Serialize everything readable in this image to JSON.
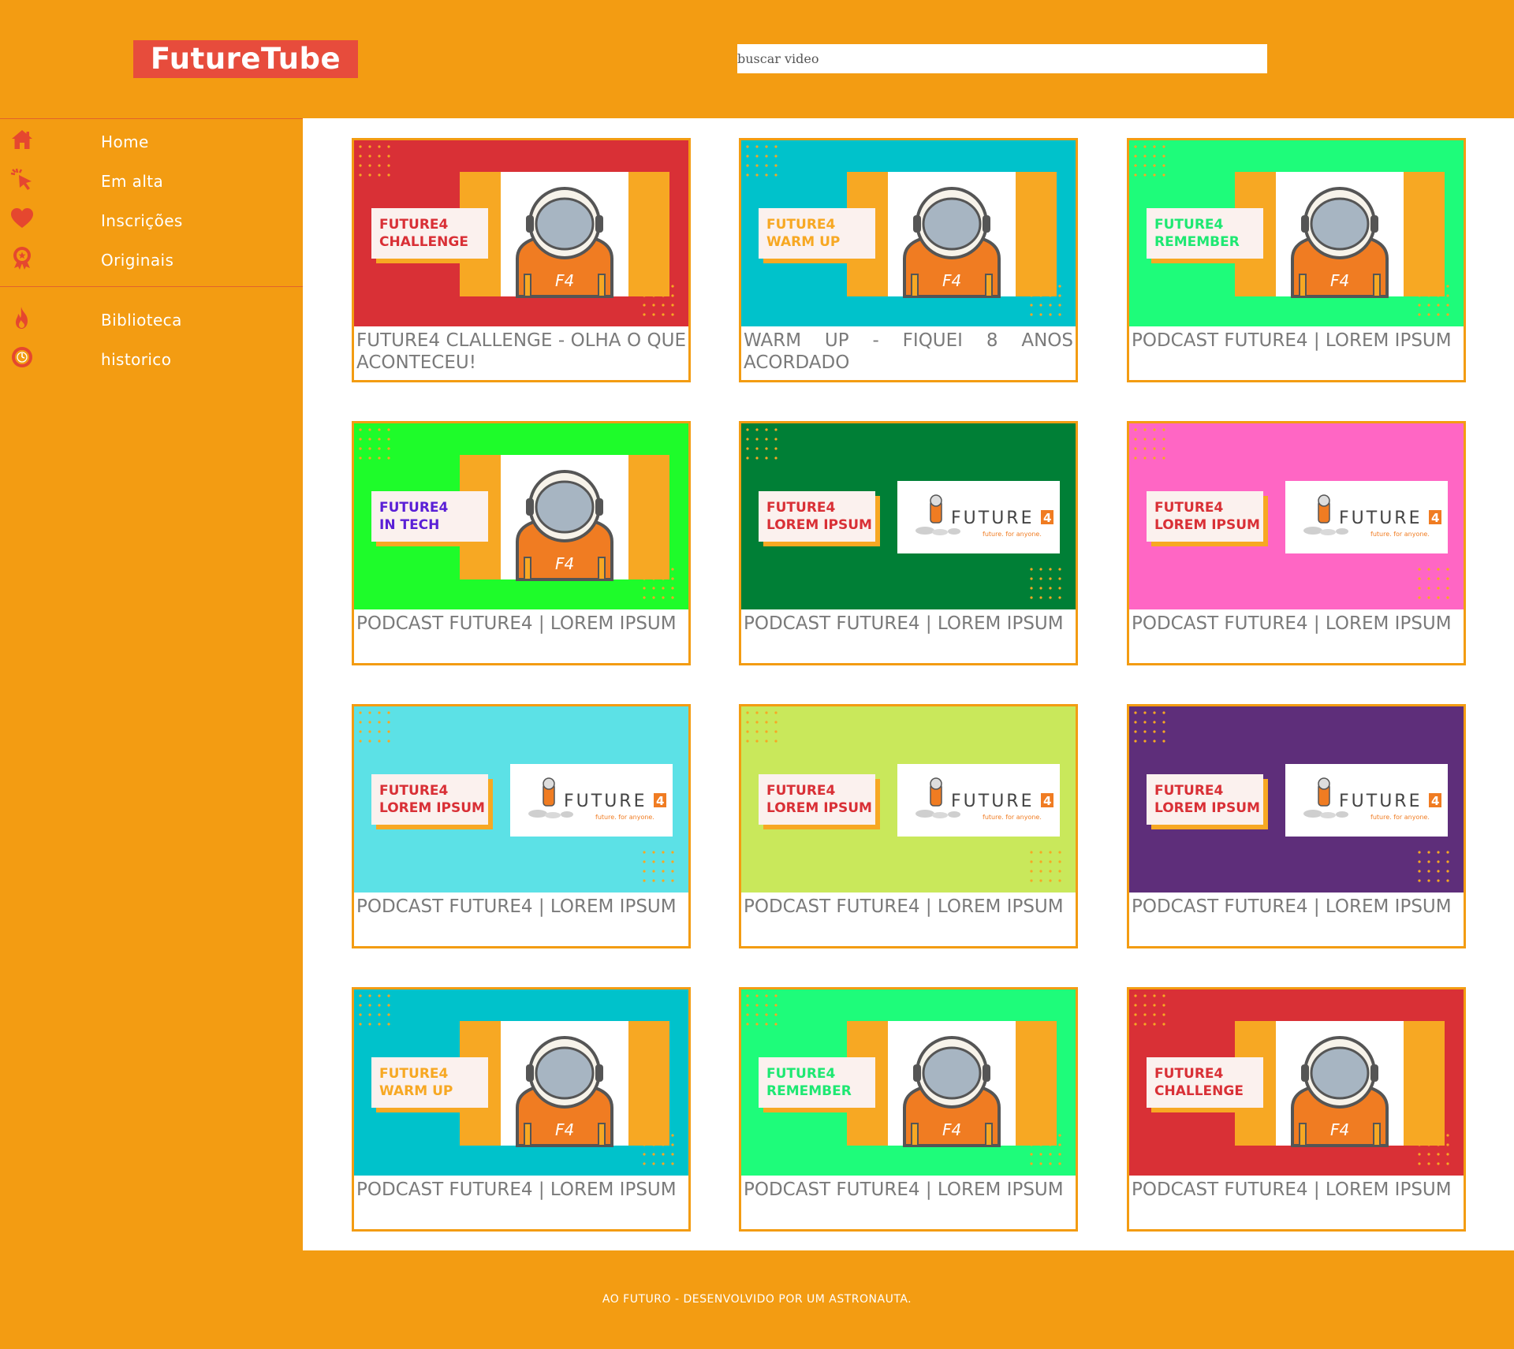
{
  "header": {
    "logo": "FutureTube",
    "search_placeholder": "buscar video"
  },
  "sidebar": {
    "primary": [
      {
        "label": "Home",
        "icon": "home-icon"
      },
      {
        "label": "Em alta",
        "icon": "cursor-click-icon"
      },
      {
        "label": "Inscrições",
        "icon": "heart-icon"
      },
      {
        "label": "Originais",
        "icon": "award-badge-icon"
      }
    ],
    "secondary": [
      {
        "label": "Biblioteca",
        "icon": "fire-icon"
      },
      {
        "label": "historico",
        "icon": "clock-icon"
      }
    ]
  },
  "colors": {
    "brand_orange": "#f39c12",
    "logo_red": "#e74c3c",
    "icon_red": "#e5472f",
    "card_title_gray": "#7a7a7a"
  },
  "videos": [
    {
      "title": "FUTURE4 CLALLENGE - OLHA O QUE ACONTECEU!",
      "thumb_line1": "FUTURE4",
      "thumb_line2": "CHALLENGE",
      "bg": "#d93036",
      "text_color": "#d93036",
      "style": "astronaut"
    },
    {
      "title": "WARM UP - FIQUEI 8 ANOS ACORDADO",
      "thumb_line1": "FUTURE4",
      "thumb_line2": "WARM UP",
      "bg": "#00c2cb",
      "text_color": "#f7a823",
      "style": "astronaut"
    },
    {
      "title": "PODCAST FUTURE4 | LOREM IPSUM",
      "thumb_line1": "FUTURE4",
      "thumb_line2": "REMEMBER",
      "bg": "#1efc7a",
      "text_color": "#1ee872",
      "style": "astronaut"
    },
    {
      "title": "PODCAST FUTURE4 | LOREM IPSUM",
      "thumb_line1": "FUTURE4",
      "thumb_line2": "IN TECH",
      "bg": "#1efc2a",
      "text_color": "#5a1fd6",
      "style": "astronaut"
    },
    {
      "title": "PODCAST FUTURE4 | LOREM IPSUM",
      "thumb_line1": "FUTURE4",
      "thumb_line2": "LOREM IPSUM",
      "bg": "#007f36",
      "text_color": "#d93036",
      "style": "logo"
    },
    {
      "title": "PODCAST FUTURE4 | LOREM IPSUM",
      "thumb_line1": "FUTURE4",
      "thumb_line2": "LOREM IPSUM",
      "bg": "#ff66c4",
      "text_color": "#d93036",
      "style": "logo"
    },
    {
      "title": "PODCAST FUTURE4 | LOREM IPSUM",
      "thumb_line1": "FUTURE4",
      "thumb_line2": "LOREM IPSUM",
      "bg": "#5ce1e6",
      "text_color": "#d93036",
      "style": "logo"
    },
    {
      "title": "PODCAST FUTURE4 | LOREM IPSUM",
      "thumb_line1": "FUTURE4",
      "thumb_line2": "LOREM IPSUM",
      "bg": "#c9e85b",
      "text_color": "#d93036",
      "style": "logo"
    },
    {
      "title": "PODCAST FUTURE4 | LOREM IPSUM",
      "thumb_line1": "FUTURE4",
      "thumb_line2": "LOREM IPSUM",
      "bg": "#5e2e7a",
      "text_color": "#d93036",
      "style": "logo"
    },
    {
      "title": "PODCAST FUTURE4 | LOREM IPSUM",
      "thumb_line1": "FUTURE4",
      "thumb_line2": "WARM UP",
      "bg": "#00c2cb",
      "text_color": "#f7a823",
      "style": "astronaut"
    },
    {
      "title": "PODCAST FUTURE4 | LOREM IPSUM",
      "thumb_line1": "FUTURE4",
      "thumb_line2": "REMEMBER",
      "bg": "#1efc7a",
      "text_color": "#1ee872",
      "style": "astronaut"
    },
    {
      "title": "PODCAST FUTURE4 | LOREM IPSUM",
      "thumb_line1": "FUTURE4",
      "thumb_line2": "CHALLENGE",
      "bg": "#d93036",
      "text_color": "#d93036",
      "style": "astronaut"
    }
  ],
  "logo_thumb": {
    "wordmark": "FUTURE",
    "wordmark_digit": "4",
    "tagline": "future. for anyone."
  },
  "footer": {
    "text": "AO FUTURO - DESENVOLVIDO POR UM ASTRONAUTA."
  }
}
